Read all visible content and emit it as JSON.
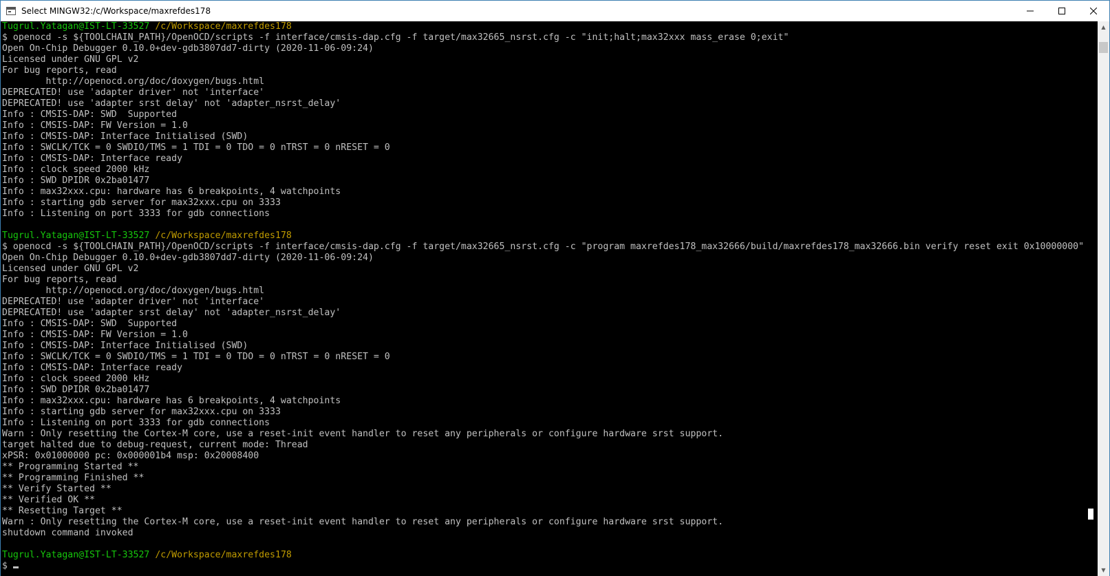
{
  "window": {
    "title": "Select MINGW32:/c/Workspace/maxrefdes178",
    "minimize_label": "─",
    "maximize_label": "☐",
    "close_label": "✕"
  },
  "colors": {
    "terminal_bg": "#000000",
    "text": "#c0c0c0",
    "prompt_user": "#16c60c",
    "prompt_path": "#c19c00"
  },
  "prompt": {
    "user": "Tugrul.Yatagan@IST-LT-33527",
    "path": "/c/Workspace/maxrefdes178"
  },
  "terminal_lines": [
    {
      "type": "prompt"
    },
    {
      "type": "text",
      "text": "$ openocd -s ${TOOLCHAIN_PATH}/OpenOCD/scripts -f interface/cmsis-dap.cfg -f target/max32665_nsrst.cfg -c \"init;halt;max32xxx mass_erase 0;exit\""
    },
    {
      "type": "text",
      "text": "Open On-Chip Debugger 0.10.0+dev-gdb3807dd7-dirty (2020-11-06-09:24)"
    },
    {
      "type": "text",
      "text": "Licensed under GNU GPL v2"
    },
    {
      "type": "text",
      "text": "For bug reports, read"
    },
    {
      "type": "text",
      "text": "        http://openocd.org/doc/doxygen/bugs.html"
    },
    {
      "type": "text",
      "text": "DEPRECATED! use 'adapter driver' not 'interface'"
    },
    {
      "type": "text",
      "text": "DEPRECATED! use 'adapter srst delay' not 'adapter_nsrst_delay'"
    },
    {
      "type": "text",
      "text": "Info : CMSIS-DAP: SWD  Supported"
    },
    {
      "type": "text",
      "text": "Info : CMSIS-DAP: FW Version = 1.0"
    },
    {
      "type": "text",
      "text": "Info : CMSIS-DAP: Interface Initialised (SWD)"
    },
    {
      "type": "text",
      "text": "Info : SWCLK/TCK = 0 SWDIO/TMS = 1 TDI = 0 TDO = 0 nTRST = 0 nRESET = 0"
    },
    {
      "type": "text",
      "text": "Info : CMSIS-DAP: Interface ready"
    },
    {
      "type": "text",
      "text": "Info : clock speed 2000 kHz"
    },
    {
      "type": "text",
      "text": "Info : SWD DPIDR 0x2ba01477"
    },
    {
      "type": "text",
      "text": "Info : max32xxx.cpu: hardware has 6 breakpoints, 4 watchpoints"
    },
    {
      "type": "text",
      "text": "Info : starting gdb server for max32xxx.cpu on 3333"
    },
    {
      "type": "text",
      "text": "Info : Listening on port 3333 for gdb connections"
    },
    {
      "type": "text",
      "text": ""
    },
    {
      "type": "prompt"
    },
    {
      "type": "text",
      "text": "$ openocd -s ${TOOLCHAIN_PATH}/OpenOCD/scripts -f interface/cmsis-dap.cfg -f target/max32665_nsrst.cfg -c \"program maxrefdes178_max32666/build/maxrefdes178_max32666.bin verify reset exit 0x10000000\""
    },
    {
      "type": "text",
      "text": "Open On-Chip Debugger 0.10.0+dev-gdb3807dd7-dirty (2020-11-06-09:24)"
    },
    {
      "type": "text",
      "text": "Licensed under GNU GPL v2"
    },
    {
      "type": "text",
      "text": "For bug reports, read"
    },
    {
      "type": "text",
      "text": "        http://openocd.org/doc/doxygen/bugs.html"
    },
    {
      "type": "text",
      "text": "DEPRECATED! use 'adapter driver' not 'interface'"
    },
    {
      "type": "text",
      "text": "DEPRECATED! use 'adapter srst delay' not 'adapter_nsrst_delay'"
    },
    {
      "type": "text",
      "text": "Info : CMSIS-DAP: SWD  Supported"
    },
    {
      "type": "text",
      "text": "Info : CMSIS-DAP: FW Version = 1.0"
    },
    {
      "type": "text",
      "text": "Info : CMSIS-DAP: Interface Initialised (SWD)"
    },
    {
      "type": "text",
      "text": "Info : SWCLK/TCK = 0 SWDIO/TMS = 1 TDI = 0 TDO = 0 nTRST = 0 nRESET = 0"
    },
    {
      "type": "text",
      "text": "Info : CMSIS-DAP: Interface ready"
    },
    {
      "type": "text",
      "text": "Info : clock speed 2000 kHz"
    },
    {
      "type": "text",
      "text": "Info : SWD DPIDR 0x2ba01477"
    },
    {
      "type": "text",
      "text": "Info : max32xxx.cpu: hardware has 6 breakpoints, 4 watchpoints"
    },
    {
      "type": "text",
      "text": "Info : starting gdb server for max32xxx.cpu on 3333"
    },
    {
      "type": "text",
      "text": "Info : Listening on port 3333 for gdb connections"
    },
    {
      "type": "text",
      "text": "Warn : Only resetting the Cortex-M core, use a reset-init event handler to reset any peripherals or configure hardware srst support."
    },
    {
      "type": "text",
      "text": "target halted due to debug-request, current mode: Thread"
    },
    {
      "type": "text",
      "text": "xPSR: 0x01000000 pc: 0x000001b4 msp: 0x20008400"
    },
    {
      "type": "text",
      "text": "** Programming Started **"
    },
    {
      "type": "text",
      "text": "** Programming Finished **"
    },
    {
      "type": "text",
      "text": "** Verify Started **"
    },
    {
      "type": "text",
      "text": "** Verified OK **"
    },
    {
      "type": "text",
      "text": "** Resetting Target **"
    },
    {
      "type": "text",
      "text": "Warn : Only resetting the Cortex-M core, use a reset-init event handler to reset any peripherals or configure hardware srst support."
    },
    {
      "type": "text",
      "text": "shutdown command invoked"
    },
    {
      "type": "text",
      "text": ""
    },
    {
      "type": "prompt"
    },
    {
      "type": "input",
      "text": "$ "
    }
  ]
}
